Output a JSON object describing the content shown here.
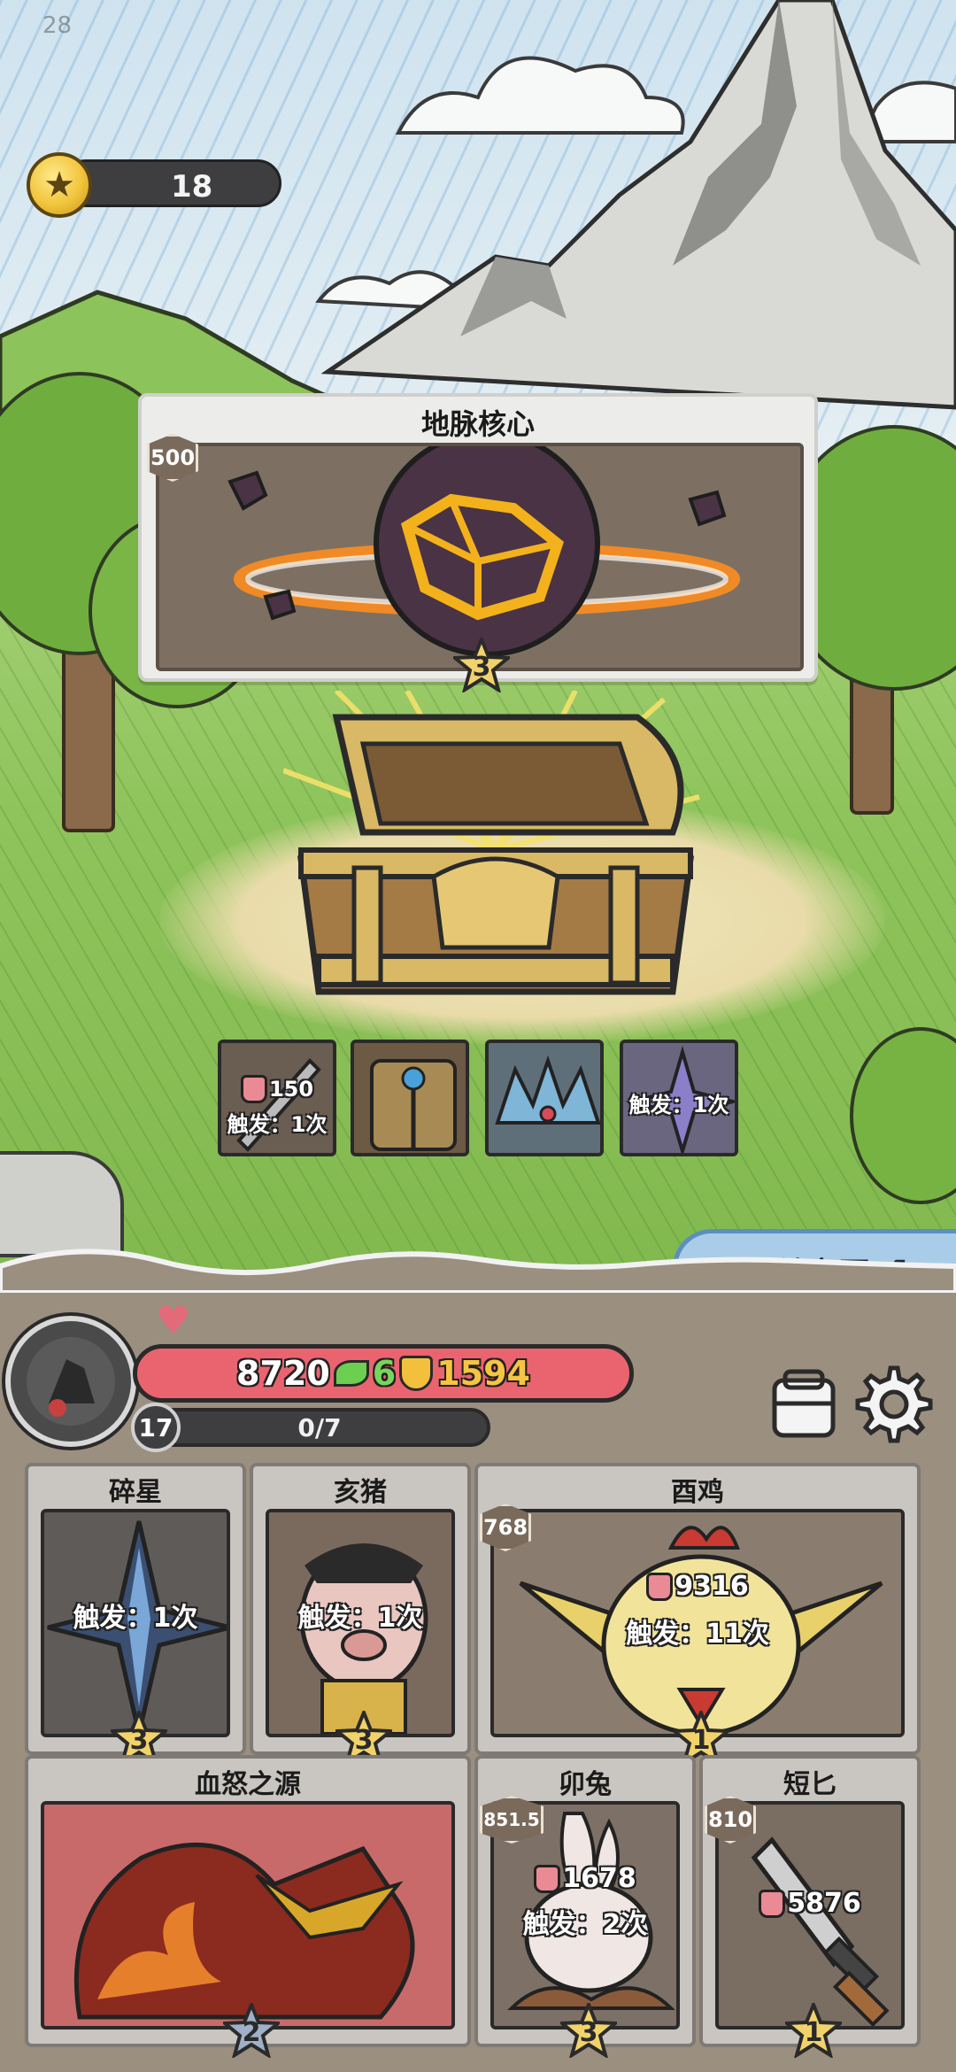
{
  "hud": {
    "fps": "28",
    "coins": "18"
  },
  "reward": {
    "title": "地脉核心",
    "cost_badge": "500",
    "stars": "3"
  },
  "loot": [
    {
      "attack": "150",
      "trigger": "触发：1次"
    },
    {
      "attack": "",
      "trigger": ""
    },
    {
      "attack": "",
      "trigger": ""
    },
    {
      "attack": "",
      "trigger": "触发：1次"
    }
  ],
  "collect_button": {
    "label": "领取并离开"
  },
  "player": {
    "health": "8720",
    "regen": "6",
    "shield": "1594",
    "level": "17",
    "xp": "0/7"
  },
  "slots": [
    {
      "name": "碎星",
      "stars": "3",
      "trigger": "触发：1次"
    },
    {
      "name": "亥猪",
      "stars": "3",
      "trigger": "触发：1次"
    },
    {
      "name": "酉鸡",
      "stars": "1",
      "badge": "768",
      "attack": "9316",
      "trigger": "触发：11次"
    },
    {
      "name": "血怒之源",
      "stars": "2"
    },
    {
      "name": "卯兔",
      "stars": "3",
      "badge": "851.5",
      "attack": "1678",
      "trigger": "触发：2次"
    },
    {
      "name": "短匕",
      "stars": "1",
      "badge": "810",
      "attack": "5876"
    }
  ],
  "colors": {
    "health_bar": "#ea6470",
    "regen": "#78d45c",
    "shield": "#f6c443",
    "collect_button": "#a9cde8"
  }
}
